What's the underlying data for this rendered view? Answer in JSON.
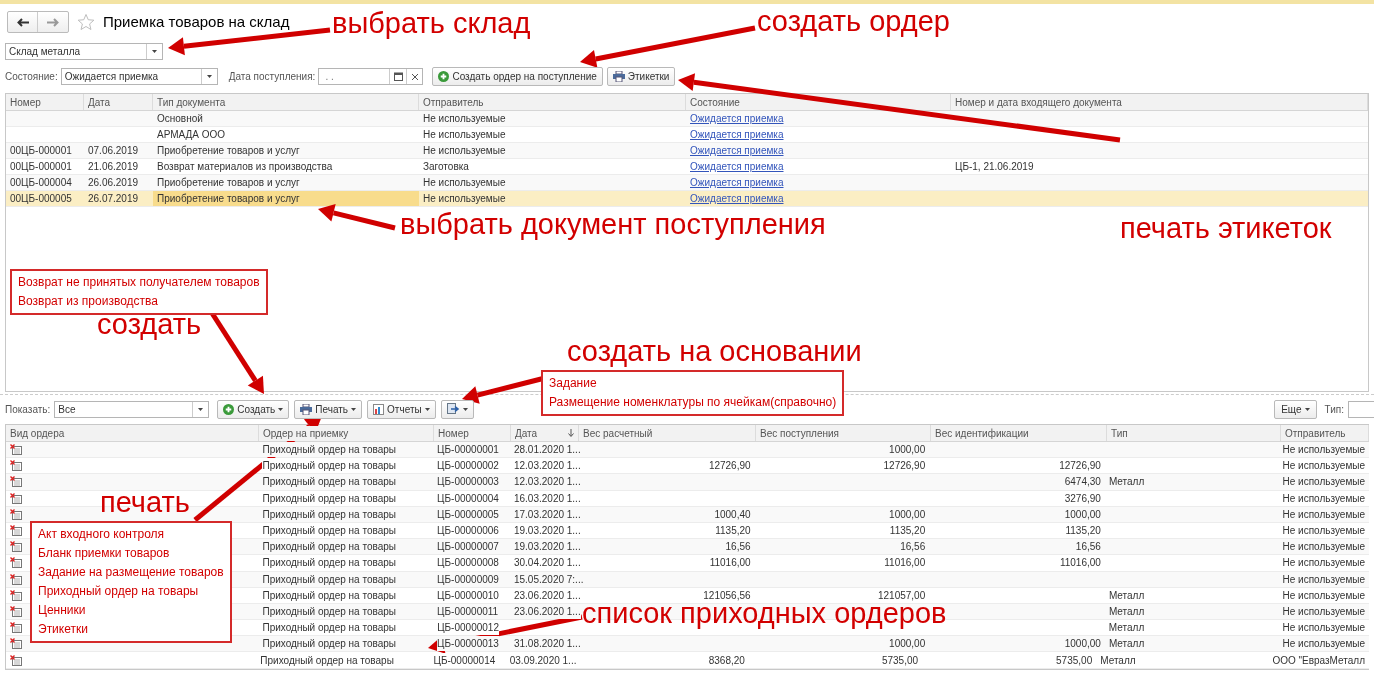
{
  "window": {
    "title": "Приемка товаров на склад"
  },
  "warehouse": {
    "value": "Склад металла"
  },
  "filters": {
    "state_label": "Состояние:",
    "state_value": "Ожидается приемка",
    "date_label": "Дата поступления:",
    "date_value": ". ."
  },
  "top_buttons": [
    {
      "kind": "create",
      "label": "Создать ордер на поступление"
    },
    {
      "kind": "print",
      "label": "Этикетки"
    }
  ],
  "documents": {
    "columns": [
      "Номер",
      "Дата",
      "Тип документа",
      "Отправитель",
      "Состояние",
      "Номер и дата входящего документа"
    ],
    "rows": [
      {
        "doc_type": "Основной",
        "sender": "Не используемые",
        "status": "Ожидается приемка",
        "selected": false
      },
      {
        "doc_type": "АРМАДА ООО",
        "sender": "Не используемые",
        "status": "Ожидается приемка",
        "selected": false
      },
      {
        "number": "00ЦБ-000001",
        "date": "07.06.2019",
        "doc_type": "Приобретение товаров и услуг",
        "sender": "Не используемые",
        "status": "Ожидается приемка",
        "selected": false
      },
      {
        "number": "00ЦБ-000001",
        "date": "21.06.2019",
        "doc_type": "Возврат материалов из производства",
        "sender": "Заготовка",
        "status": "Ожидается приемка",
        "incoming": "ЦБ-1, 21.06.2019",
        "selected": false
      },
      {
        "number": "00ЦБ-000004",
        "date": "26.06.2019",
        "doc_type": "Приобретение товаров и услуг",
        "sender": "Не используемые",
        "status": "Ожидается приемка",
        "selected": false
      },
      {
        "number": "00ЦБ-000005",
        "date": "26.07.2019",
        "doc_type": "Приобретение товаров и услуг",
        "sender": "Не используемые",
        "status": "Ожидается приемка",
        "selected": true
      }
    ]
  },
  "orders_toolbar": {
    "show_label": "Показать:",
    "show_value": "Все",
    "buttons": [
      {
        "kind": "create",
        "label": "Создать"
      },
      {
        "kind": "print",
        "label": "Печать"
      },
      {
        "kind": "reports",
        "label": "Отчеты"
      },
      {
        "kind": "based_on"
      }
    ],
    "more": "Еще",
    "type_label": "Тип:"
  },
  "orders": {
    "columns": [
      {
        "label": "Вид ордера"
      },
      {
        "label": "Ордер на приемку"
      },
      {
        "label": "Номер"
      },
      {
        "label": "Дата",
        "sorted": true
      },
      {
        "label": "Вес расчетный"
      },
      {
        "label": "Вес поступления"
      },
      {
        "label": "Вес идентификации"
      },
      {
        "label": "Тип"
      },
      {
        "label": "Отправитель"
      }
    ],
    "rows": [
      {
        "order": "Приходный ордер на товары",
        "number": "ЦБ-00000001",
        "date": "28.01.2020 1...",
        "received": "1000,00",
        "sender": "Не используемые"
      },
      {
        "order": "Приходный ордер на товары",
        "number": "ЦБ-00000002",
        "date": "12.03.2020 1...",
        "calc": "12726,90",
        "received": "12726,90",
        "ident": "12726,90",
        "sender": "Не используемые"
      },
      {
        "order": "Приходный ордер на товары",
        "number": "ЦБ-00000003",
        "date": "12.03.2020 1...",
        "ident": "6474,30",
        "type": "Металл",
        "sender": "Не используемые"
      },
      {
        "order": "Приходный ордер на товары",
        "number": "ЦБ-00000004",
        "date": "16.03.2020 1...",
        "ident": "3276,90",
        "sender": "Не используемые"
      },
      {
        "order": "Приходный ордер на товары",
        "number": "ЦБ-00000005",
        "date": "17.03.2020 1...",
        "calc": "1000,40",
        "received": "1000,00",
        "ident": "1000,00",
        "sender": "Не используемые"
      },
      {
        "order": "Приходный ордер на товары",
        "number": "ЦБ-00000006",
        "date": "19.03.2020 1...",
        "calc": "1135,20",
        "received": "1135,20",
        "ident": "1135,20",
        "sender": "Не используемые"
      },
      {
        "order": "Приходный ордер на товары",
        "number": "ЦБ-00000007",
        "date": "19.03.2020 1...",
        "calc": "16,56",
        "received": "16,56",
        "ident": "16,56",
        "sender": "Не используемые"
      },
      {
        "order": "Приходный ордер на товары",
        "number": "ЦБ-00000008",
        "date": "30.04.2020 1...",
        "calc": "11016,00",
        "received": "11016,00",
        "ident": "11016,00",
        "sender": "Не используемые"
      },
      {
        "order": "Приходный ордер на товары",
        "number": "ЦБ-00000009",
        "date": "15.05.2020 7:...",
        "sender": "Не используемые"
      },
      {
        "order": "Приходный ордер на товары",
        "number": "ЦБ-00000010",
        "date": "23.06.2020 1...",
        "calc": "121056,56",
        "received": "121057,00",
        "type": "Металл",
        "sender": "Не используемые"
      },
      {
        "order": "Приходный ордер на товары",
        "number": "ЦБ-00000011",
        "date": "23.06.2020 1...",
        "type": "Металл",
        "sender": "Не используемые"
      },
      {
        "order": "Приходный ордер на товары",
        "number": "ЦБ-00000012",
        "type": "Металл",
        "sender": "Не используемые"
      },
      {
        "order": "Приходный ордер на товары",
        "number": "ЦБ-00000013",
        "date": "31.08.2020 1...",
        "received": "1000,00",
        "ident": "1000,00",
        "type": "Металл",
        "sender": "Не используемые"
      },
      {
        "order": "Приходный ордер на товары",
        "number": "ЦБ-00000014",
        "date": "03.09.2020 1...",
        "calc": "8368,20",
        "received": "5735,00",
        "ident": "5735,00",
        "type": "Металл",
        "sender": "ООО \"ЕвразМеталл"
      }
    ]
  },
  "annotations": [
    {
      "kind": "caption",
      "text": "выбрать склад"
    },
    {
      "kind": "caption",
      "text": "создать ордер"
    },
    {
      "kind": "caption",
      "text": "выбрать документ поступления"
    },
    {
      "kind": "caption",
      "text": "печать этикеток"
    },
    {
      "kind": "list",
      "items": [
        "Возврат не принятых получателем товаров",
        "Возврат из производства"
      ]
    },
    {
      "kind": "caption",
      "text": "создать"
    },
    {
      "kind": "caption",
      "text": "создать на основании"
    },
    {
      "kind": "list",
      "items": [
        "Задание",
        "Размещение номенклатуры по ячейкам(справочно)"
      ]
    },
    {
      "kind": "caption",
      "text": "печать"
    },
    {
      "kind": "list",
      "items": [
        "Акт входного контроля",
        "Бланк приемки товаров",
        "Задание на размещение товаров",
        "Приходный ордер на товары",
        "Ценники",
        "Этикетки"
      ]
    },
    {
      "kind": "caption",
      "text": "список приходных ордеров"
    }
  ]
}
